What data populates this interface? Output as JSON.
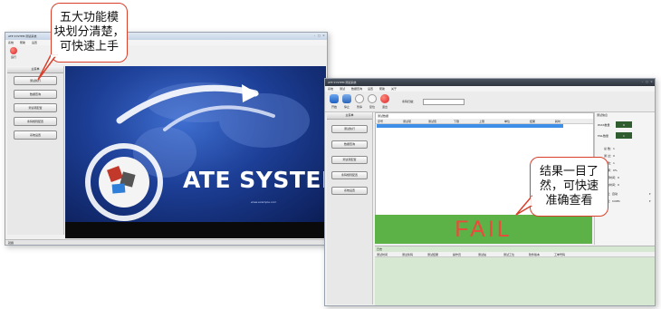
{
  "window_left": {
    "title": "ATE SYSTEM 测试系统",
    "menu": [
      "系统",
      "帮助",
      "设置"
    ],
    "toolbar_label": "运行",
    "nav_header": "主菜单",
    "nav_items": [
      "测试执行",
      "数据查询",
      "测试项配置",
      "条码规则配置",
      "系统设置"
    ],
    "banner_text": "ATE SYSTEM",
    "banner_subtext": "www.example.com",
    "status_text": "就绪"
  },
  "window_right": {
    "title": "ATE SYSTEM 测试系统",
    "menu": [
      "系统",
      "测试",
      "数据查询",
      "设置",
      "帮助",
      "关于"
    ],
    "toolbar_items": [
      "开始",
      "停止",
      "暂停",
      "复位",
      "退出"
    ],
    "barcode_label": "条码扫描：",
    "nav_header": "主菜单",
    "nav_items": [
      "测试执行",
      "数据查询",
      "测试项配置",
      "条码规则配置",
      "系统设置"
    ],
    "table_title": "测试数据",
    "table_headers": [
      "序号",
      "测试项",
      "测试值",
      "下限",
      "上限",
      "单位",
      "结果",
      "耗时"
    ],
    "result_text": "FAIL",
    "log_title": "日志",
    "log_headers": [
      "测试时间",
      "测试条码",
      "测试结果",
      "操作员",
      "测试站",
      "测试工位",
      "软件版本",
      "工单号码"
    ],
    "info_title": "测试信息",
    "info_rows": [
      {
        "label": "PASS数量",
        "value": "0"
      },
      {
        "label": "FAIL数量",
        "value": "1"
      }
    ],
    "stats_rows": [
      "总 数：1",
      "通 过：0",
      "失 败：1",
      "良 率：0%",
      "测试时间：0",
      "平均时间：0"
    ],
    "option_rows": [
      "模式：自动",
      "端口：COM1"
    ]
  },
  "callouts": {
    "left": [
      "五大功能模",
      "块划分清楚，",
      "可快速上手"
    ],
    "right": [
      "结果一目了",
      "然，可快速",
      "准确查看"
    ]
  },
  "colors": {
    "result_bg": "#5cb246",
    "result_text": "#e94b3c",
    "callout_border": "#d8402c",
    "log_panel": "#d6e8d2",
    "info_value_bg": "#2f5d30"
  }
}
